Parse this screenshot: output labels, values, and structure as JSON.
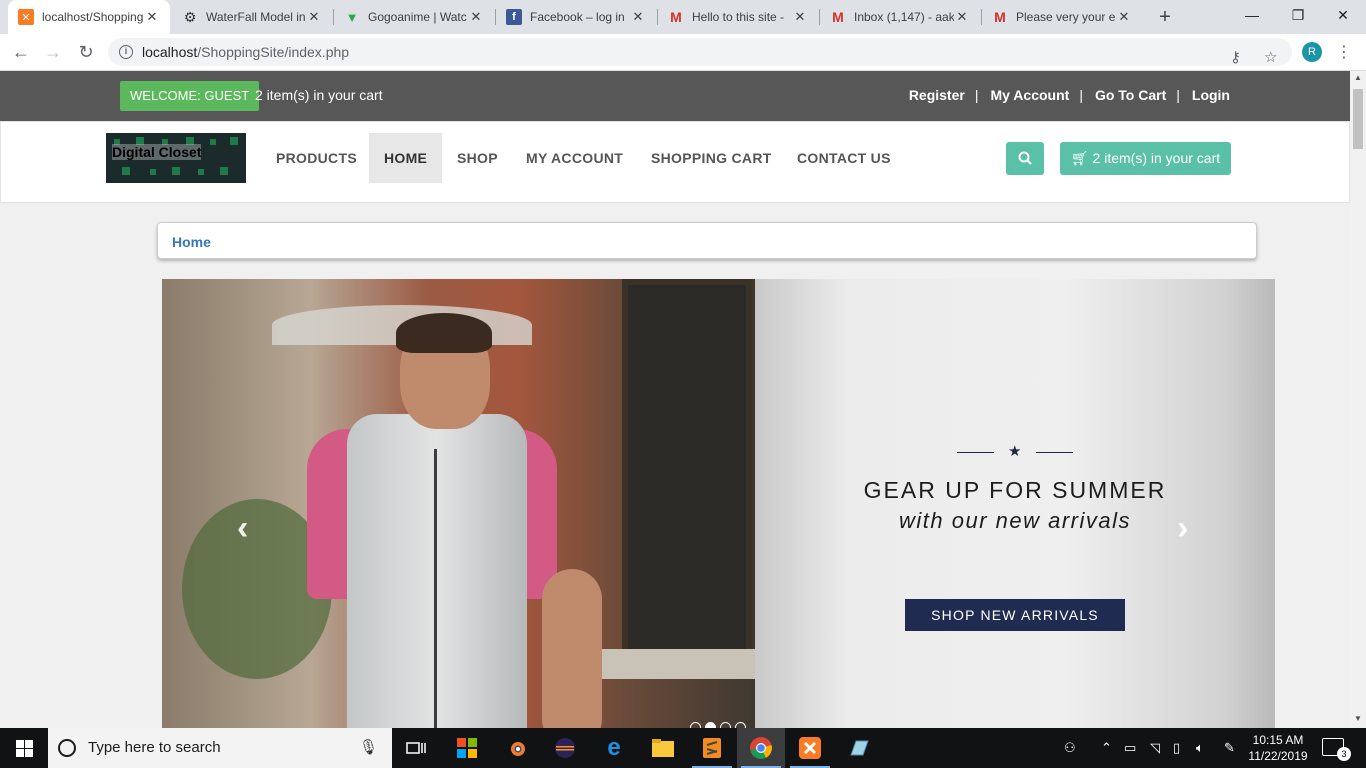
{
  "browser": {
    "tabs": [
      {
        "title": "localhost/Shopping",
        "icon": "xampp-icon",
        "active": true
      },
      {
        "title": "WaterFall Model in",
        "icon": "gear-icon",
        "active": false
      },
      {
        "title": "Gogoanime | Watc",
        "icon": "gogoanime-icon",
        "active": false
      },
      {
        "title": "Facebook – log in",
        "icon": "facebook-icon",
        "active": false
      },
      {
        "title": "Hello to this site -",
        "icon": "gmail-icon",
        "active": false
      },
      {
        "title": "Inbox (1,147) - aak",
        "icon": "gmail-icon",
        "active": false
      },
      {
        "title": "Please very your e",
        "icon": "gmail-icon",
        "active": false
      }
    ],
    "url_host": "localhost",
    "url_path": "/ShoppingSite/index.php",
    "profile_initial": "R"
  },
  "site": {
    "welcome_label": "WELCOME: GUEST",
    "cart_status": "2 item(s) in your cart",
    "top_links": [
      "Register",
      "My Account",
      "Go To Cart",
      "Login"
    ],
    "logo_text": "Digital Closet",
    "nav": [
      "PRODUCTS",
      "HOME",
      "SHOP",
      "MY ACCOUNT",
      "SHOPPING CART",
      "CONTACT US"
    ],
    "active_nav": "HOME",
    "cart_button": "2 item(s) in your cart",
    "breadcrumb": "Home",
    "colors": {
      "topbar": "#575757",
      "welcome": "#5cb85c",
      "accent": "#5bc0a8",
      "link": "#337ab7",
      "promo_button": "#202b52"
    }
  },
  "carousel": {
    "star": "★",
    "title": "GEAR UP FOR SUMMER",
    "subtitle": "with our new arrivals",
    "button": "SHOP NEW ARRIVALS",
    "prev": "‹",
    "next": "›",
    "slide_count": 4,
    "active_slide": 2
  },
  "taskbar": {
    "search_placeholder": "Type here to search",
    "time": "10:15 AM",
    "date": "11/22/2019",
    "notification_count": "3"
  }
}
